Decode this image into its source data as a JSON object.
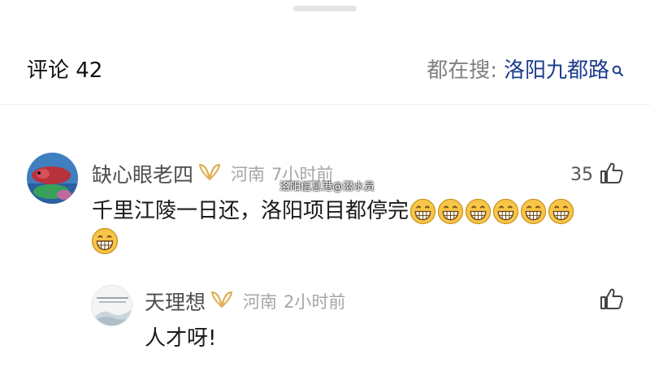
{
  "header": {
    "comments_label": "评论 42",
    "hot_search_label": "都在搜:",
    "hot_search_term": "洛阳九都路"
  },
  "comments": [
    {
      "user_name": "缺心眼老四",
      "location": "河南",
      "time": "7小时前",
      "text": "千里江陵一日还，洛阳项目都停完",
      "emoji_name": "grinning-face-emoji",
      "emoji_count": 7,
      "likes": "35"
    },
    {
      "user_name": "天理想",
      "location": "河南",
      "time": "2小时前",
      "text": "人才呀!"
    }
  ],
  "watermark": "洛阳信息港@潜水员",
  "colors": {
    "hot_search_term": "#1e3d8f",
    "vip_badge": "#e0b15a",
    "meta_gray": "#a6a6a6"
  }
}
